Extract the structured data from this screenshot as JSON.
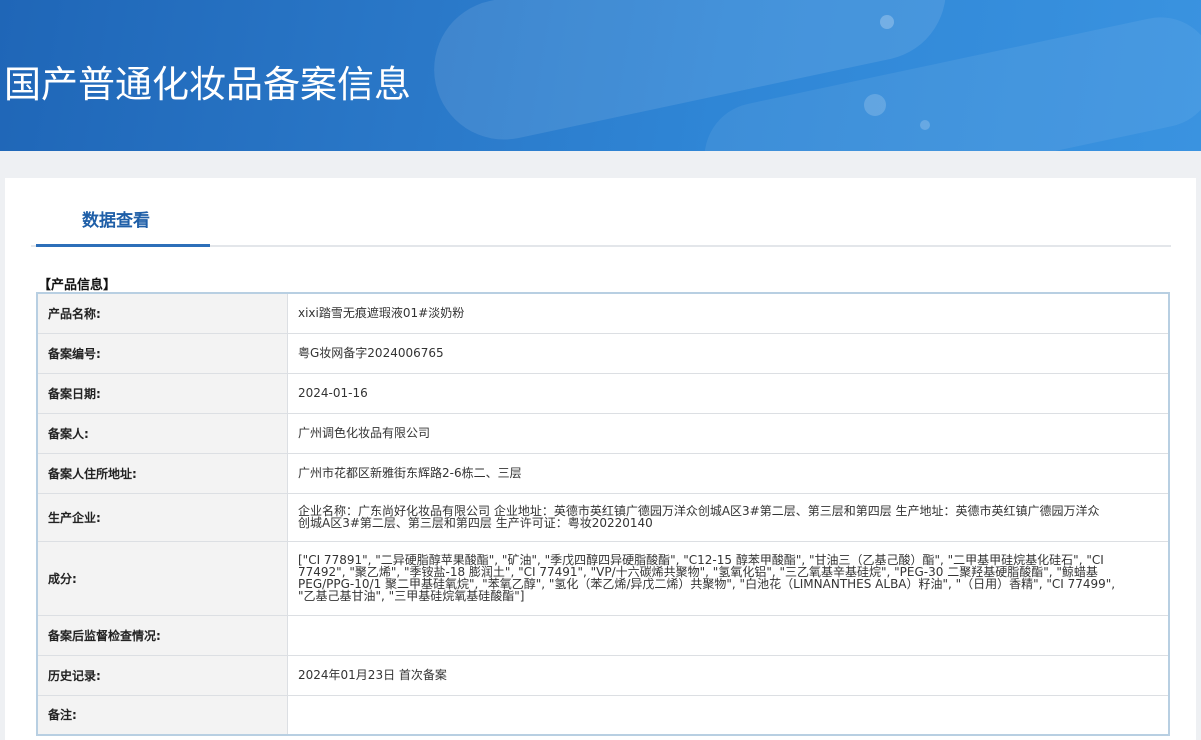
{
  "header": {
    "title": "国产普通化妆品备案信息"
  },
  "tabs": [
    {
      "label": "数据查看",
      "active": true
    }
  ],
  "section": {
    "title": "【产品信息】"
  },
  "rows": [
    {
      "label": "产品名称:",
      "value": "xixi踏雪无痕遮瑕液01#淡奶粉"
    },
    {
      "label": "备案编号:",
      "value": "粤G妆网备字2024006765"
    },
    {
      "label": "备案日期:",
      "value": "2024-01-16"
    },
    {
      "label": "备案人:",
      "value": "广州调色化妆品有限公司"
    },
    {
      "label": "备案人住所地址:",
      "value": "广州市花都区新雅街东辉路2-6栋二、三层"
    },
    {
      "label": "生产企业:",
      "value": "企业名称：广东尚好化妆品有限公司 企业地址：英德市英红镇广德园万洋众创城A区3#第二层、第三层和第四层 生产地址：英德市英红镇广德园万洋众创城A区3#第二层、第三层和第四层 生产许可证：粤妆20220140"
    },
    {
      "label": "成分:",
      "value": "[\"CI 77891\", \"二异硬脂醇苹果酸酯\", \"矿油\", \"季戊四醇四异硬脂酸酯\", \"C12-15 醇苯甲酸酯\", \"甘油三（乙基己酸）酯\", \"二甲基甲硅烷基化硅石\", \"CI 77492\", \"聚乙烯\", \"季铵盐-18 膨润土\", \"CI 77491\", \"VP/十六碳烯共聚物\", \"氢氧化铝\", \"三乙氧基辛基硅烷\", \"PEG-30 二聚羟基硬脂酸酯\", \"鲸蜡基 PEG/PPG-10/1 聚二甲基硅氧烷\", \"苯氧乙醇\", \"氢化（苯乙烯/异戊二烯）共聚物\", \"白池花（LIMNANTHES ALBA）籽油\", \"（日用）香精\", \"CI 77499\", \"乙基己基甘油\", \"三甲基硅烷氧基硅酸酯\"]"
    },
    {
      "label": "备案后监督检查情况:",
      "value": ""
    },
    {
      "label": "历史记录:",
      "value": "2024年01月23日 首次备案"
    },
    {
      "label": "备注:",
      "value": ""
    }
  ]
}
